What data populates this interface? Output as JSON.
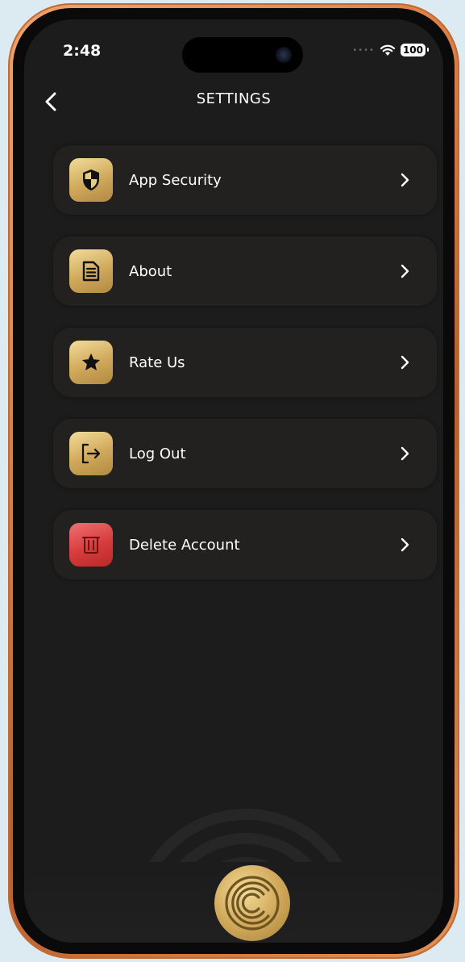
{
  "status": {
    "time": "2:48",
    "battery": "100"
  },
  "header": {
    "title": "SETTINGS",
    "back_icon": "chevron-left-icon"
  },
  "menu": [
    {
      "label": "App Security",
      "icon": "shield-icon"
    },
    {
      "label": "About",
      "icon": "document-icon"
    },
    {
      "label": "Rate Us",
      "icon": "star-icon"
    },
    {
      "label": "Log Out",
      "icon": "logout-icon"
    },
    {
      "label": "Delete Account",
      "icon": "trash-icon"
    }
  ],
  "colors": {
    "background": "#1c1c1c",
    "card": "#222120",
    "gold": "#d2aa5c",
    "danger": "#d63c3c",
    "frame": "#d8783d"
  },
  "footer": {
    "logo_icon": "app-logo-icon"
  }
}
